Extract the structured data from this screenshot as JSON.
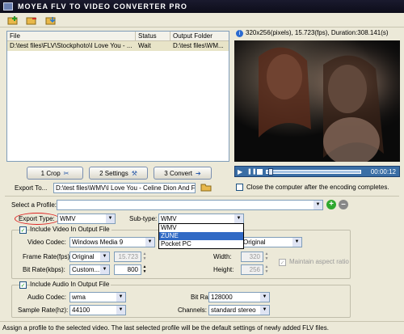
{
  "app": {
    "title": "MOYEA FLV TO VIDEO CONVERTER PRO"
  },
  "toolbar": {
    "icons": [
      "add-file-icon",
      "open-folder-icon",
      "remove-file-icon"
    ]
  },
  "file_list": {
    "headers": {
      "file": "File",
      "status": "Status",
      "output": "Output Folder"
    },
    "rows": [
      {
        "file": "D:\\test files\\FLV\\Stockphoto\\I Love You - ...",
        "status": "Wait",
        "output": "D:\\test files\\WM..."
      }
    ]
  },
  "video_info": "320x256(pixels), 15.723(fps), Duration:308.141(s)",
  "player": {
    "time": "00:00:12"
  },
  "steps": {
    "crop": "1 Crop",
    "settings": "2 Settings",
    "convert": "3 Convert"
  },
  "export": {
    "label": "Export To...",
    "path": "D:\\test files\\WMV\\I Love You - Celine Dion And Fa"
  },
  "shutdown": {
    "label": "Close the computer after the encoding completes."
  },
  "profile": {
    "label": "Select a Profile:",
    "value": ""
  },
  "export_type": {
    "label": "Export Type:",
    "value": "WMV"
  },
  "subtype": {
    "label": "Sub-type:",
    "value": "WMV",
    "options": [
      "WMV",
      "ZUNE",
      "Pocket PC"
    ],
    "highlighted": "ZUNE"
  },
  "video": {
    "include_label": "Include Video In Output File",
    "codec_label": "Video Codec:",
    "codec": "Windows Media 9",
    "framerate_label": "Frame Rate(fps):",
    "framerate": "Original",
    "framerate_num": "15.723",
    "bitrate_label": "Bit Rate(kbps):",
    "bitrate": "Custom...",
    "bitrate_num": "800",
    "right_combo": "Original",
    "width_label": "Width:",
    "width": "320",
    "height_label": "Height:",
    "height": "256",
    "aspect_label": "Maintain aspect ratio"
  },
  "audio": {
    "include_label": "Include Audio In Output File",
    "codec_label": "Audio Codec:",
    "codec": "wma",
    "samplerate_label": "Sample Rate(hz):",
    "samplerate": "44100",
    "bitrate_label": "Bit Rate(bps):",
    "bitrate": "128000",
    "channels_label": "Channels:",
    "channels": "standard stereo"
  },
  "status": "Assign a profile to the selected video. The last selected profile will be the default settings of newly added FLV files."
}
